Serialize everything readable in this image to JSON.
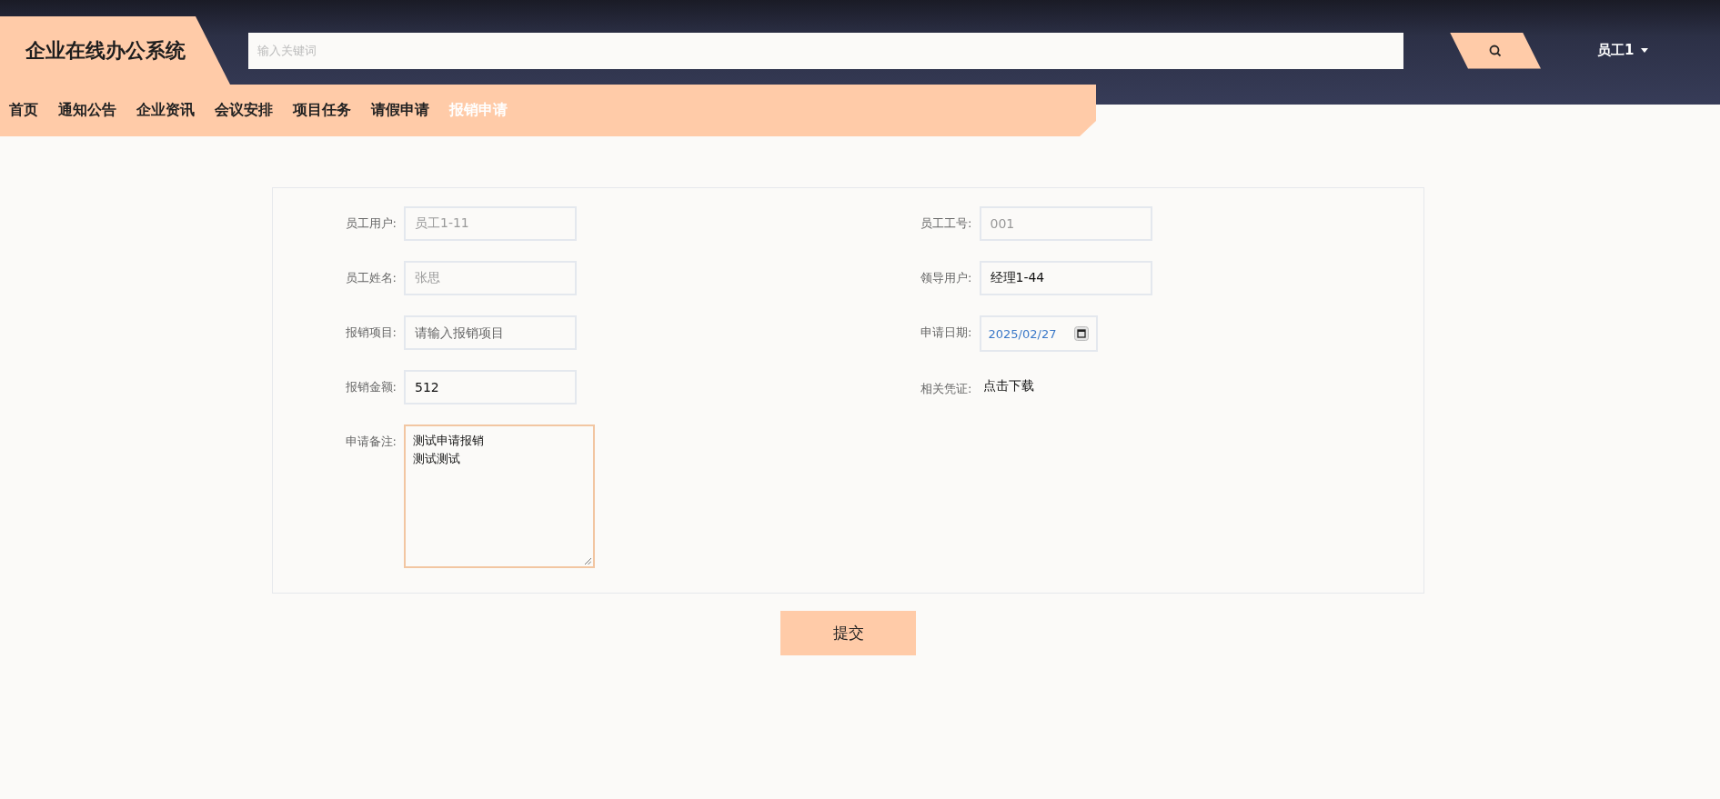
{
  "header": {
    "logo": "企业在线办公系统",
    "search": {
      "placeholder": "输入关键词"
    },
    "user": {
      "name": "员工1"
    }
  },
  "nav": [
    {
      "label": "首页",
      "selected": false
    },
    {
      "label": "通知公告",
      "selected": false
    },
    {
      "label": "企业资讯",
      "selected": false
    },
    {
      "label": "会议安排",
      "selected": false
    },
    {
      "label": "项目任务",
      "selected": false
    },
    {
      "label": "请假申请",
      "selected": false
    },
    {
      "label": "报销申请",
      "selected": true
    }
  ],
  "form": {
    "left_fields": [
      {
        "label": "员工用户:",
        "kind": "input",
        "value": "员工1-11",
        "disabled": true
      },
      {
        "label": "员工姓名:",
        "kind": "input",
        "value": "张思",
        "disabled": true
      },
      {
        "label": "报销项目:",
        "kind": "input",
        "placeholder": "请输入报销项目"
      },
      {
        "label": "报销金额:",
        "kind": "input",
        "value": "512",
        "disabled": false
      },
      {
        "label": "申请备注:",
        "kind": "textarea",
        "lines": [
          "测试申请报销",
          "测试测试"
        ],
        "focused": true
      }
    ],
    "right_fields": [
      {
        "label": "员工工号:",
        "kind": "input",
        "value": "001",
        "disabled": true
      },
      {
        "label": "领导用户:",
        "kind": "input",
        "value": "经理1-44",
        "disabled": false
      },
      {
        "label": "申请日期:",
        "kind": "date",
        "value": "2025/02/27"
      },
      {
        "label": "相关凭证:",
        "kind": "link",
        "value": "点击下载"
      }
    ],
    "submit": "提交"
  }
}
